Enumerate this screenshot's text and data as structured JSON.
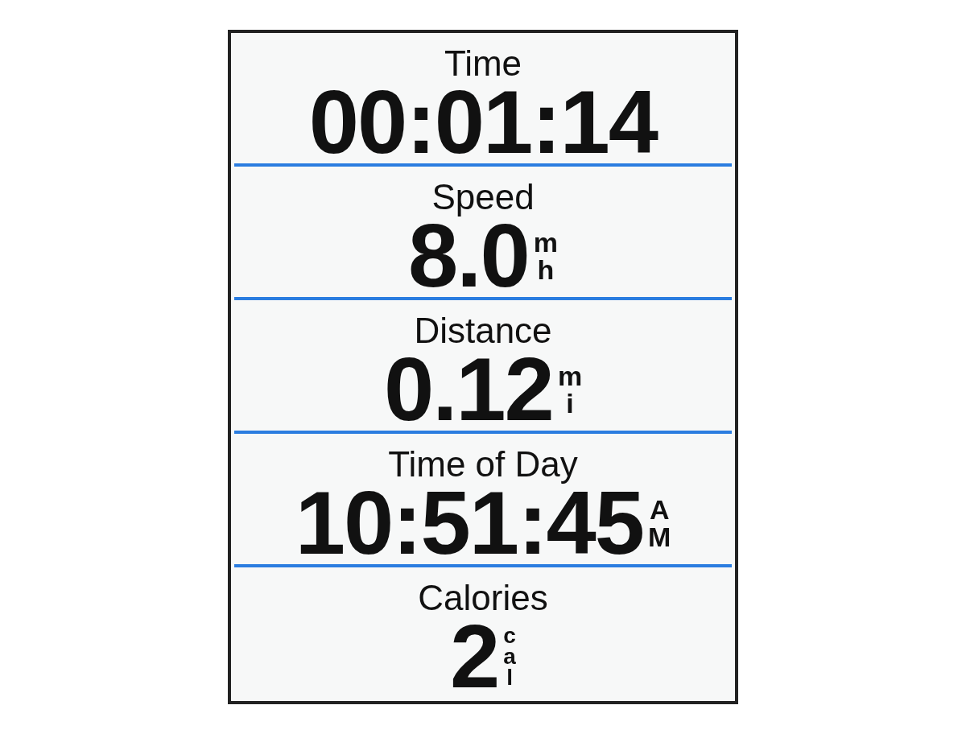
{
  "fields": [
    {
      "label": "Time",
      "value": "00:01:14"
    },
    {
      "label": "Speed",
      "value": "8.0",
      "unit_letters": [
        "m",
        "h"
      ]
    },
    {
      "label": "Distance",
      "value": "0.12",
      "unit_letters": [
        "m",
        "i"
      ]
    },
    {
      "label": "Time of Day",
      "value": "10:51:45",
      "unit_letters": [
        "A",
        "M"
      ]
    },
    {
      "label": "Calories",
      "value": "2",
      "unit_letters": [
        "c",
        "a",
        "l"
      ]
    }
  ]
}
